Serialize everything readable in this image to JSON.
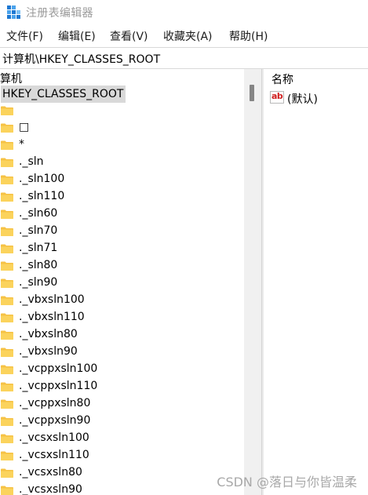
{
  "window": {
    "title": "注册表编辑器",
    "icon": "registry-editor-icon"
  },
  "menu": [
    {
      "label": "文件(F)"
    },
    {
      "label": "编辑(E)"
    },
    {
      "label": "查看(V)"
    },
    {
      "label": "收藏夹(A)"
    },
    {
      "label": "帮助(H)"
    }
  ],
  "address": {
    "path": "计算机\\HKEY_CLASSES_ROOT"
  },
  "tree": {
    "root_label": "算机",
    "selected_label": "HKEY_CLASSES_ROOT",
    "items": [
      {
        "label": "",
        "icon": "folder-icon"
      },
      {
        "label": "□",
        "icon": "folder-icon"
      },
      {
        "label": "*",
        "icon": "folder-icon"
      },
      {
        "label": "._sln",
        "icon": "folder-icon"
      },
      {
        "label": "._sln100",
        "icon": "folder-icon"
      },
      {
        "label": "._sln110",
        "icon": "folder-icon"
      },
      {
        "label": "._sln60",
        "icon": "folder-icon"
      },
      {
        "label": "._sln70",
        "icon": "folder-icon"
      },
      {
        "label": "._sln71",
        "icon": "folder-icon"
      },
      {
        "label": "._sln80",
        "icon": "folder-icon"
      },
      {
        "label": "._sln90",
        "icon": "folder-icon"
      },
      {
        "label": "._vbxsln100",
        "icon": "folder-icon"
      },
      {
        "label": "._vbxsln110",
        "icon": "folder-icon"
      },
      {
        "label": "._vbxsln80",
        "icon": "folder-icon"
      },
      {
        "label": "._vbxsln90",
        "icon": "folder-icon"
      },
      {
        "label": "._vcppxsln100",
        "icon": "folder-icon"
      },
      {
        "label": "._vcppxsln110",
        "icon": "folder-icon"
      },
      {
        "label": "._vcppxsln80",
        "icon": "folder-icon"
      },
      {
        "label": "._vcppxsln90",
        "icon": "folder-icon"
      },
      {
        "label": "._vcsxsln100",
        "icon": "folder-icon"
      },
      {
        "label": "._vcsxsln110",
        "icon": "folder-icon"
      },
      {
        "label": "._vcsxsln80",
        "icon": "folder-icon"
      },
      {
        "label": "._vcsxsln90",
        "icon": "folder-icon"
      }
    ]
  },
  "values": {
    "column_header": "名称",
    "rows": [
      {
        "icon": "string-value-icon",
        "icon_text": "ab",
        "name": "(默认)"
      }
    ]
  },
  "watermark": "CSDN @落日与你皆温柔",
  "colors": {
    "folder": "#f6c244",
    "selection": "#d9d9d9",
    "value_icon_text": "#d02020"
  }
}
